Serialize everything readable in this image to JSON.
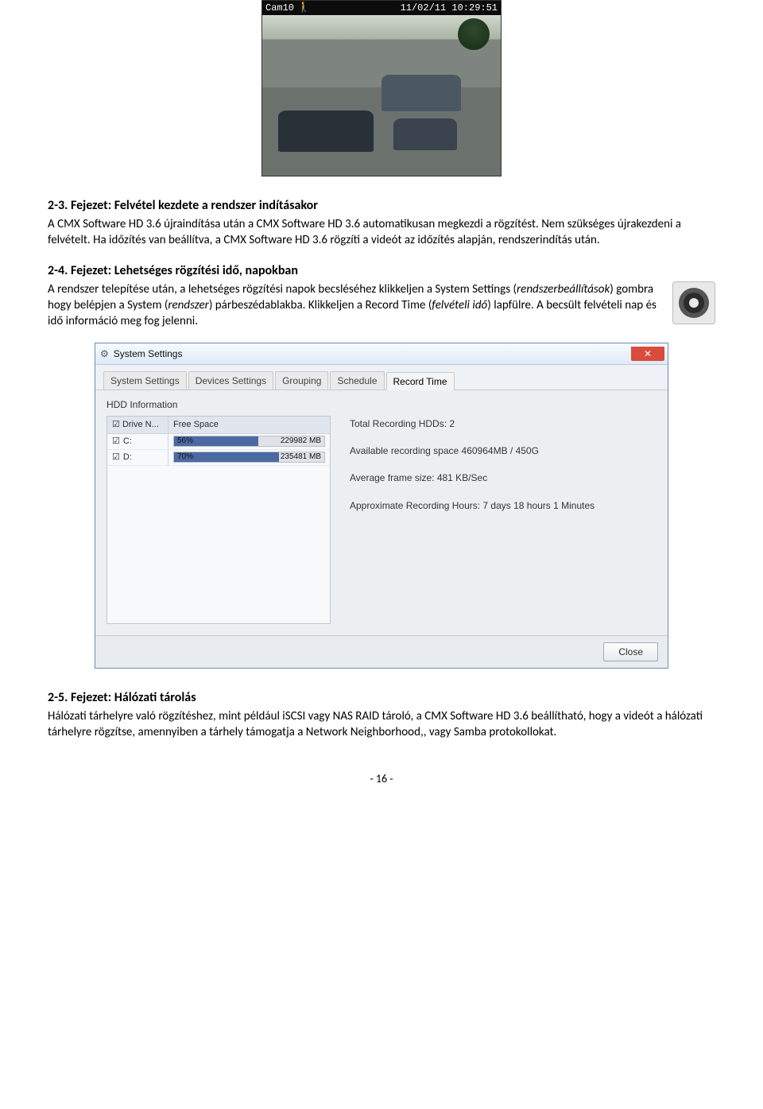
{
  "camera": {
    "label": "Cam10",
    "timestamp": "11/02/11 10:29:51"
  },
  "sec23": {
    "title": "2-3. Fejezet: Felvétel kezdete a rendszer indításakor",
    "body": "A CMX Software HD 3.6 újraindítása után a CMX Software HD 3.6 automatikusan megkezdi a rögzítést. Nem szükséges újrakezdeni a felvételt. Ha időzítés van beállítva, a CMX Software HD 3.6 rögzíti a videót az időzítés alapján, rendszerindítás után."
  },
  "sec24": {
    "title": "2-4. Fejezet: Lehetséges rögzítési idő, napokban",
    "p1a": "A rendszer telepítése után, a lehetséges rögzítési napok becsléséhez klikkeljen a System Settings (",
    "p1b": ") gombra hogy belépjen a System (",
    "p1c": ") párbeszédablakba. Klikkeljen a Record Time (",
    "p1d": ") lapfülre. A becsült felvételi nap és idő információ meg fog jelenni.",
    "it_settings": "rendszerbeállítások",
    "it_system": "rendszer",
    "it_rectime": "felvételi idő"
  },
  "dialog": {
    "title": "System Settings",
    "tabs": [
      "System Settings",
      "Devices Settings",
      "Grouping",
      "Schedule",
      "Record Time"
    ],
    "group": "HDD Information",
    "col_drive": "Drive N...",
    "col_free": "Free Space",
    "drives": [
      {
        "name": "C:",
        "pct": "56%",
        "size": "229982 MB",
        "fill": 56
      },
      {
        "name": "D:",
        "pct": "70%",
        "size": "235481 MB",
        "fill": 70
      }
    ],
    "info": {
      "l1": "Total Recording HDDs: 2",
      "l2": "Available recording space 460964MB / 450G",
      "l3": "Average frame size: 481 KB/Sec",
      "l4": "Approximate Recording Hours: 7 days  18 hours  1 Minutes"
    },
    "close_btn": "Close"
  },
  "sec25": {
    "title": "2-5. Fejezet: Hálózati tárolás",
    "body": "Hálózati tárhelyre való rögzítéshez, mint például iSCSI vagy NAS RAID tároló, a CMX Software HD 3.6 beállítható, hogy a videót a hálózati tárhelyre rögzítse, amennyiben a tárhely támogatja a Network Neighborhood,, vagy Samba protokollokat."
  },
  "page_num": "- 16 -"
}
